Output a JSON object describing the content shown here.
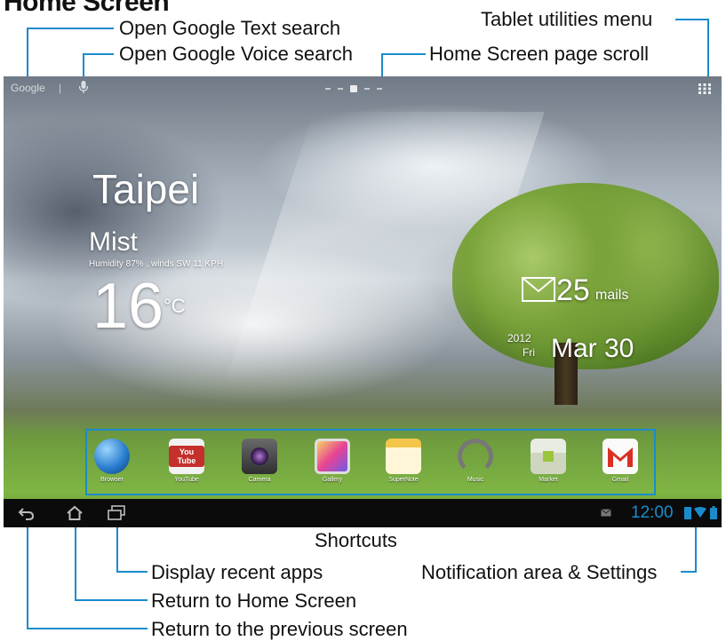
{
  "page_title": "Home Screen",
  "callouts": {
    "text_search": "Open Google Text search",
    "voice_search": "Open Google Voice search",
    "tablet_menu": "Tablet utilities menu",
    "page_scroll": "Home Screen page scroll",
    "shortcuts": "Shortcuts",
    "recent_apps": "Display recent apps",
    "home": "Return to Home Screen",
    "back": "Return to the previous screen",
    "notification": "Notification area & Settings"
  },
  "screen": {
    "google_label": "Google",
    "weather": {
      "city": "Taipei",
      "condition": "Mist",
      "detail": "Humidity 87% , winds SW 11 KPH",
      "temperature": "16",
      "unit": "°C"
    },
    "mail": {
      "count": "25",
      "label": "mails"
    },
    "date": {
      "year": "2012",
      "weekday": "Fri",
      "day": "Mar 30"
    },
    "apps": [
      {
        "label": "Browser",
        "icon": "browser-icon"
      },
      {
        "label": "YouTube",
        "icon": "youtube-icon"
      },
      {
        "label": "Camera",
        "icon": "camera-icon"
      },
      {
        "label": "Gallery",
        "icon": "gallery-icon"
      },
      {
        "label": "SuperNote",
        "icon": "supernote-icon"
      },
      {
        "label": "Music",
        "icon": "music-icon"
      },
      {
        "label": "Market",
        "icon": "market-icon"
      },
      {
        "label": "Gmail",
        "icon": "gmail-icon"
      }
    ],
    "clock": "12:00",
    "youtube_text": "You Tube"
  },
  "colors": {
    "accent": "#1a8ccc",
    "system_bar": "#0b0b0b"
  }
}
